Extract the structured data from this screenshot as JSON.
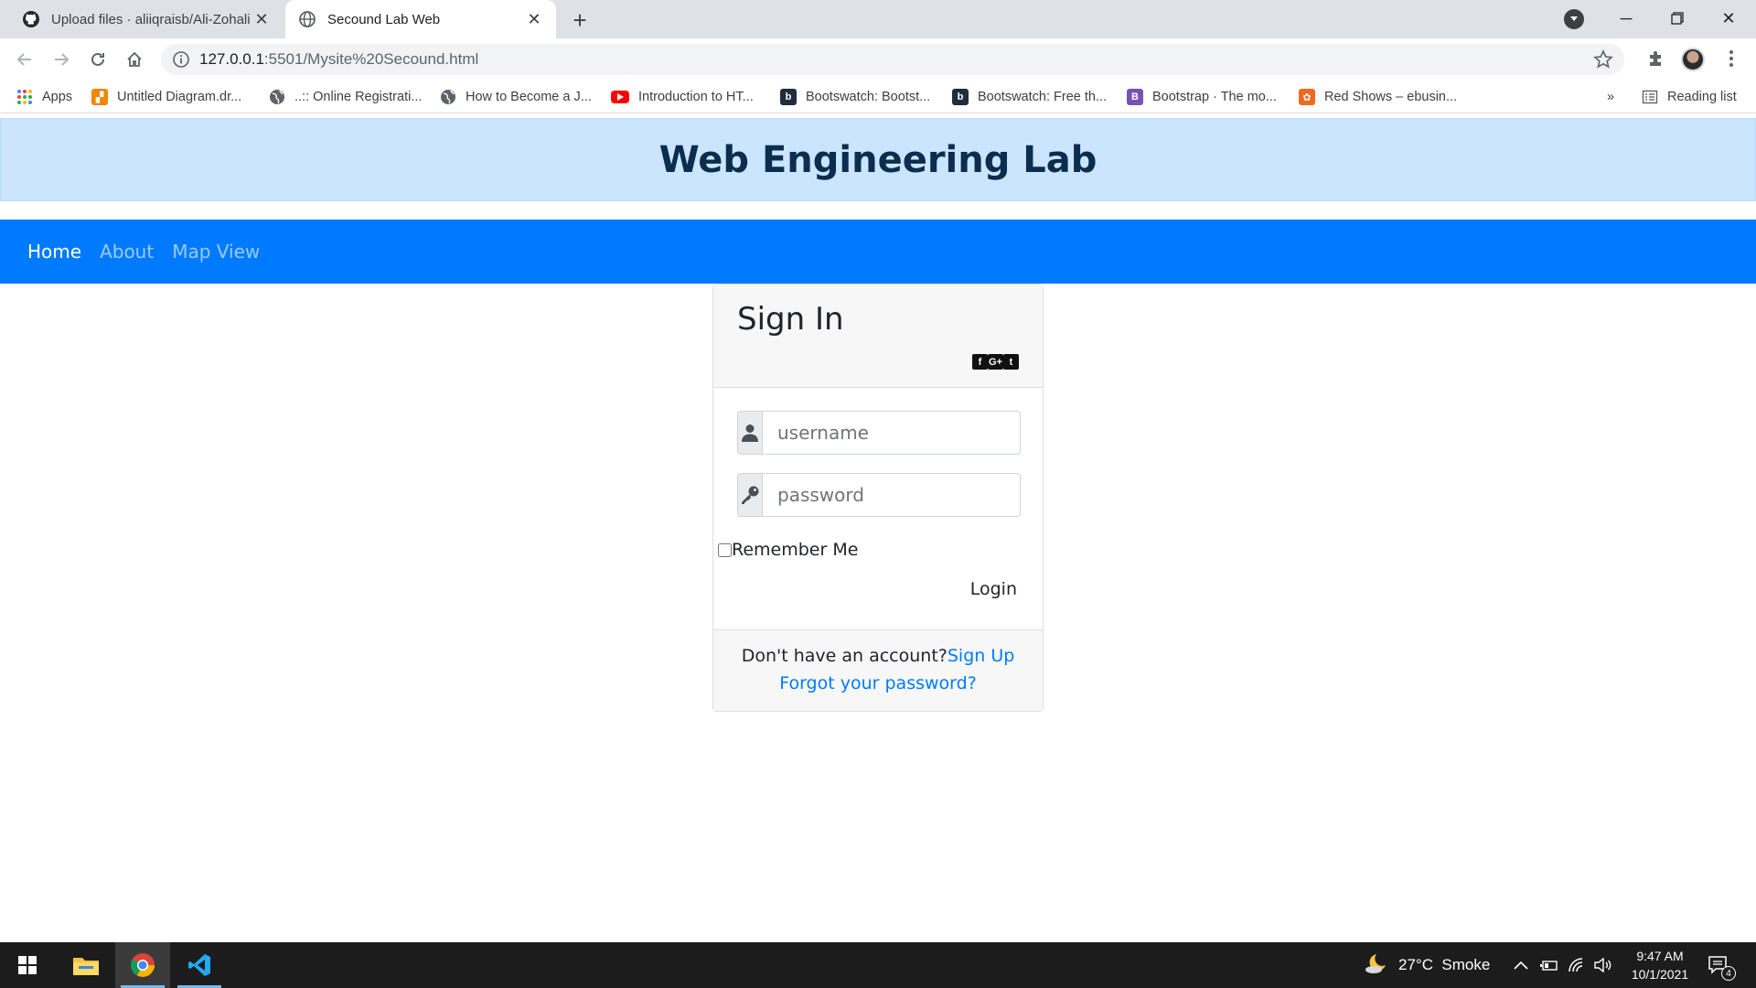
{
  "browser": {
    "tabs": [
      {
        "title": "Upload files · aliiqraisb/Ali-Zohali",
        "icon": "github-icon",
        "active": false
      },
      {
        "title": "Secound Lab Web",
        "icon": "globe-icon",
        "active": true
      }
    ],
    "url_host": "127.0.0.1",
    "url_rest": ":5501/Mysite%20Secound.html",
    "bookmarks": [
      {
        "label": "Apps",
        "icon": "apps-grid-icon",
        "color": "#4285f4"
      },
      {
        "label": "Untitled Diagram.dr...",
        "icon": "drawio-icon",
        "color": "#f08705"
      },
      {
        "label": "..:: Online Registrati...",
        "icon": "globe-icon",
        "color": "#5f6368"
      },
      {
        "label": "How to Become a J...",
        "icon": "globe-icon",
        "color": "#5f6368"
      },
      {
        "label": "Introduction to HT...",
        "icon": "youtube-icon",
        "color": "#ff0000"
      },
      {
        "label": "Bootswatch: Bootst...",
        "icon": "bootswatch-icon",
        "color": "#1f2d3d"
      },
      {
        "label": "Bootswatch: Free th...",
        "icon": "bootswatch-icon",
        "color": "#1f2d3d"
      },
      {
        "label": "Bootstrap · The mo...",
        "icon": "bootstrap-icon",
        "color": "#7952b3"
      },
      {
        "label": "Red Shows – ebusin...",
        "icon": "redshows-icon",
        "color": "#f06a24"
      }
    ],
    "overflow": "»",
    "reading_list": "Reading list"
  },
  "site": {
    "banner_title": "Web Engineering Lab",
    "nav": [
      {
        "label": "Home",
        "active": true
      },
      {
        "label": "About",
        "active": false
      },
      {
        "label": "Map View",
        "active": false
      }
    ]
  },
  "signin": {
    "title": "Sign In",
    "social": [
      "f",
      "G+",
      "t"
    ],
    "username_placeholder": "username",
    "password_placeholder": "password",
    "remember_label": "Remember Me",
    "login_label": "Login",
    "no_account_text": "Don't have an account?",
    "signup_link": "Sign Up",
    "forgot_link": "Forgot your password?"
  },
  "taskbar": {
    "weather": "27°C  Smoke",
    "time": "9:47 AM",
    "date": "10/1/2021",
    "notifications": "4"
  },
  "colors": {
    "primary": "#007bff",
    "banner_bg": "#cce5ff",
    "banner_text": "#0b2e4f"
  }
}
